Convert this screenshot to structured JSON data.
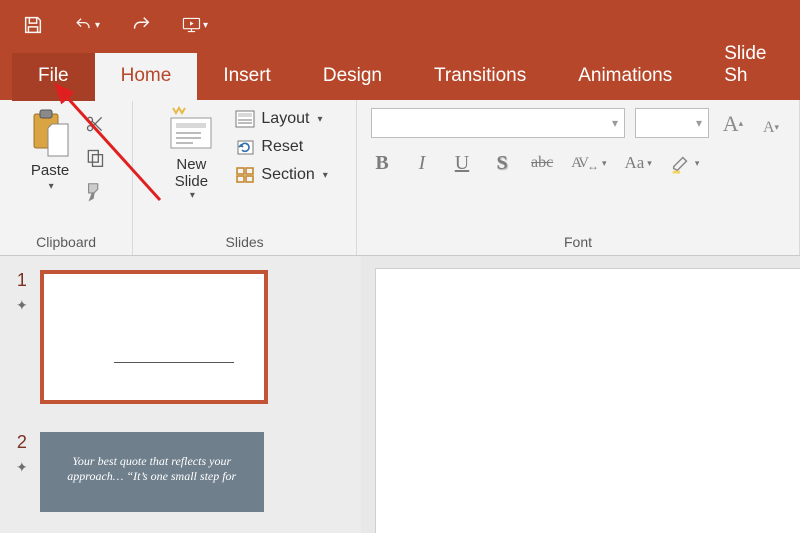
{
  "qat": {
    "icons": [
      "save",
      "undo",
      "redo",
      "slideshow"
    ]
  },
  "tabs": {
    "file": "File",
    "home": "Home",
    "insert": "Insert",
    "design": "Design",
    "transitions": "Transitions",
    "animations": "Animations",
    "slideshow": "Slide Sh"
  },
  "ribbon": {
    "clipboard": {
      "paste": "Paste",
      "label": "Clipboard"
    },
    "slides": {
      "new_slide": "New\nSlide",
      "layout": "Layout",
      "reset": "Reset",
      "section": "Section",
      "label": "Slides"
    },
    "font": {
      "label": "Font",
      "bold": "B",
      "italic": "I",
      "underline": "U",
      "shadow": "S",
      "strike": "abc",
      "spacing": "AV",
      "case": "Aa",
      "incA": "A",
      "decA": "A"
    }
  },
  "slides_panel": {
    "s1": {
      "num": "1"
    },
    "s2": {
      "num": "2",
      "quote": "Your best quote that reflects your approach… “It’s one small step for"
    }
  }
}
